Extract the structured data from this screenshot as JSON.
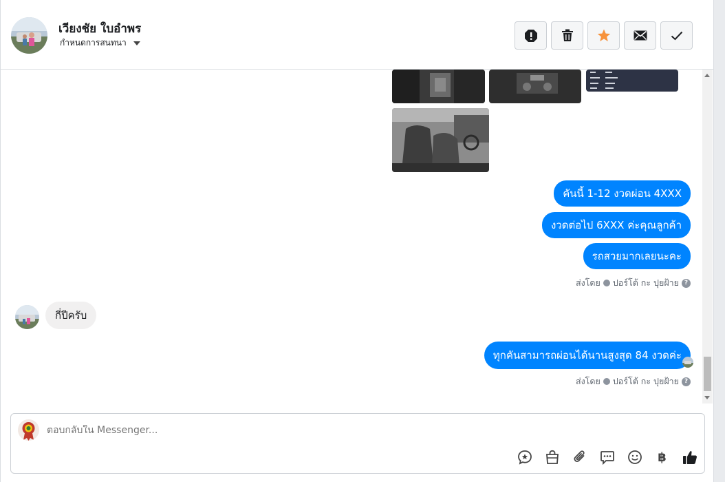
{
  "contact": {
    "name": "เวียงชัย ใบอำพร",
    "status": "กำหนดการสนทนา"
  },
  "actions": [
    {
      "name": "report-icon"
    },
    {
      "name": "trash-icon"
    },
    {
      "name": "star-icon"
    },
    {
      "name": "envelope-icon"
    },
    {
      "name": "check-icon"
    }
  ],
  "messages": {
    "out1": "คันนี้ 1-12 งวดผ่อน 4XXX",
    "out2": "งวดต่อไป 6XXX ค่ะคุณลูกค้า",
    "out3": "รถสวยมากเลยนะคะ",
    "in1": "กี่ปีครับ",
    "out4": "ทุกคันสามารถผ่อนได้นานสูงสุด 84 งวดค่ะ"
  },
  "sent_by": {
    "prefix": "ส่งโดย",
    "name": "ปอร์โต้ กะ ปุยฝ้าย",
    "help": "?"
  },
  "composer": {
    "placeholder": "ตอบกลับใน Messenger...",
    "tools": [
      "saved-reply-icon",
      "shop-bag-icon",
      "attachment-icon",
      "chat-dots-icon",
      "emoji-icon",
      "baht-icon",
      "like-icon"
    ],
    "baht_symbol": "฿"
  },
  "colors": {
    "accent": "#0084ff",
    "star": "#f7923b",
    "border": "#dadde1"
  }
}
